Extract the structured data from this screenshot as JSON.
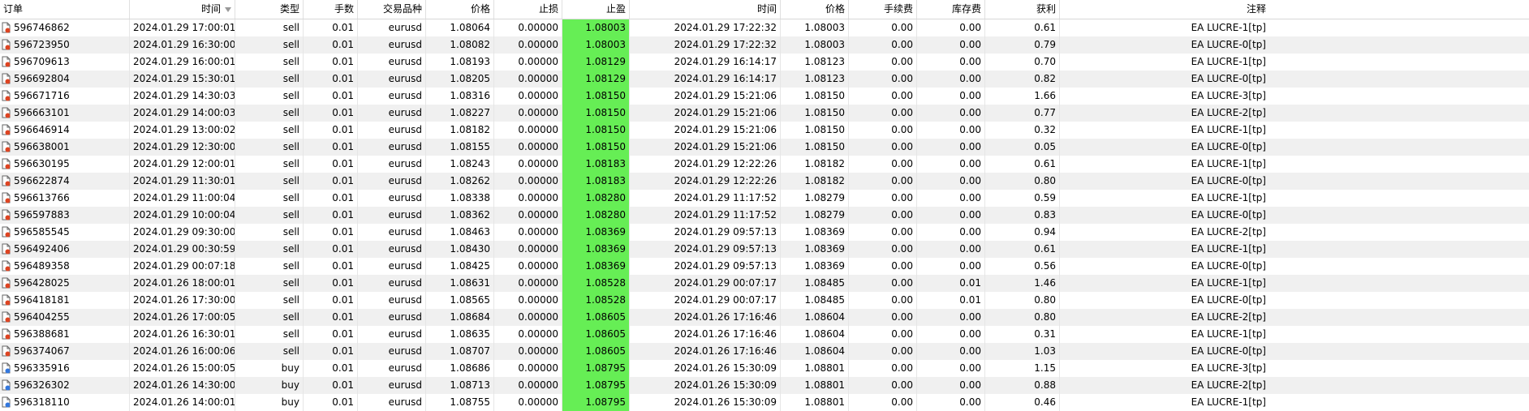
{
  "columns": {
    "order": "订单",
    "open_time": "时间",
    "type": "类型",
    "lots": "手数",
    "symbol": "交易品种",
    "open_price": "价格",
    "sl": "止损",
    "tp": "止盈",
    "close_time": "时间",
    "close_price": "价格",
    "commission": "手续费",
    "swap": "库存费",
    "profit": "获利",
    "comment": "注释"
  },
  "colors": {
    "tp_highlight": "#66ee55",
    "sell_icon": "#dd4422",
    "buy_icon": "#3377dd",
    "row_alt": "#f0f0f0"
  },
  "sort_icon": "sort-desc-icon",
  "rows": [
    {
      "order": "596746862",
      "open_time": "2024.01.29 17:00:01",
      "type": "sell",
      "lots": "0.01",
      "symbol": "eurusd",
      "open_price": "1.08064",
      "sl": "0.00000",
      "tp": "1.08003",
      "close_time": "2024.01.29 17:22:32",
      "close_price": "1.08003",
      "commission": "0.00",
      "swap": "0.00",
      "profit": "0.61",
      "comment": "EA LUCRE-1[tp]"
    },
    {
      "order": "596723950",
      "open_time": "2024.01.29 16:30:00",
      "type": "sell",
      "lots": "0.01",
      "symbol": "eurusd",
      "open_price": "1.08082",
      "sl": "0.00000",
      "tp": "1.08003",
      "close_time": "2024.01.29 17:22:32",
      "close_price": "1.08003",
      "commission": "0.00",
      "swap": "0.00",
      "profit": "0.79",
      "comment": "EA LUCRE-0[tp]"
    },
    {
      "order": "596709613",
      "open_time": "2024.01.29 16:00:01",
      "type": "sell",
      "lots": "0.01",
      "symbol": "eurusd",
      "open_price": "1.08193",
      "sl": "0.00000",
      "tp": "1.08129",
      "close_time": "2024.01.29 16:14:17",
      "close_price": "1.08123",
      "commission": "0.00",
      "swap": "0.00",
      "profit": "0.70",
      "comment": "EA LUCRE-1[tp]"
    },
    {
      "order": "596692804",
      "open_time": "2024.01.29 15:30:01",
      "type": "sell",
      "lots": "0.01",
      "symbol": "eurusd",
      "open_price": "1.08205",
      "sl": "0.00000",
      "tp": "1.08129",
      "close_time": "2024.01.29 16:14:17",
      "close_price": "1.08123",
      "commission": "0.00",
      "swap": "0.00",
      "profit": "0.82",
      "comment": "EA LUCRE-0[tp]"
    },
    {
      "order": "596671716",
      "open_time": "2024.01.29 14:30:03",
      "type": "sell",
      "lots": "0.01",
      "symbol": "eurusd",
      "open_price": "1.08316",
      "sl": "0.00000",
      "tp": "1.08150",
      "close_time": "2024.01.29 15:21:06",
      "close_price": "1.08150",
      "commission": "0.00",
      "swap": "0.00",
      "profit": "1.66",
      "comment": "EA LUCRE-3[tp]"
    },
    {
      "order": "596663101",
      "open_time": "2024.01.29 14:00:03",
      "type": "sell",
      "lots": "0.01",
      "symbol": "eurusd",
      "open_price": "1.08227",
      "sl": "0.00000",
      "tp": "1.08150",
      "close_time": "2024.01.29 15:21:06",
      "close_price": "1.08150",
      "commission": "0.00",
      "swap": "0.00",
      "profit": "0.77",
      "comment": "EA LUCRE-2[tp]"
    },
    {
      "order": "596646914",
      "open_time": "2024.01.29 13:00:02",
      "type": "sell",
      "lots": "0.01",
      "symbol": "eurusd",
      "open_price": "1.08182",
      "sl": "0.00000",
      "tp": "1.08150",
      "close_time": "2024.01.29 15:21:06",
      "close_price": "1.08150",
      "commission": "0.00",
      "swap": "0.00",
      "profit": "0.32",
      "comment": "EA LUCRE-1[tp]"
    },
    {
      "order": "596638001",
      "open_time": "2024.01.29 12:30:00",
      "type": "sell",
      "lots": "0.01",
      "symbol": "eurusd",
      "open_price": "1.08155",
      "sl": "0.00000",
      "tp": "1.08150",
      "close_time": "2024.01.29 15:21:06",
      "close_price": "1.08150",
      "commission": "0.00",
      "swap": "0.00",
      "profit": "0.05",
      "comment": "EA LUCRE-0[tp]"
    },
    {
      "order": "596630195",
      "open_time": "2024.01.29 12:00:01",
      "type": "sell",
      "lots": "0.01",
      "symbol": "eurusd",
      "open_price": "1.08243",
      "sl": "0.00000",
      "tp": "1.08183",
      "close_time": "2024.01.29 12:22:26",
      "close_price": "1.08182",
      "commission": "0.00",
      "swap": "0.00",
      "profit": "0.61",
      "comment": "EA LUCRE-1[tp]"
    },
    {
      "order": "596622874",
      "open_time": "2024.01.29 11:30:01",
      "type": "sell",
      "lots": "0.01",
      "symbol": "eurusd",
      "open_price": "1.08262",
      "sl": "0.00000",
      "tp": "1.08183",
      "close_time": "2024.01.29 12:22:26",
      "close_price": "1.08182",
      "commission": "0.00",
      "swap": "0.00",
      "profit": "0.80",
      "comment": "EA LUCRE-0[tp]"
    },
    {
      "order": "596613766",
      "open_time": "2024.01.29 11:00:04",
      "type": "sell",
      "lots": "0.01",
      "symbol": "eurusd",
      "open_price": "1.08338",
      "sl": "0.00000",
      "tp": "1.08280",
      "close_time": "2024.01.29 11:17:52",
      "close_price": "1.08279",
      "commission": "0.00",
      "swap": "0.00",
      "profit": "0.59",
      "comment": "EA LUCRE-1[tp]"
    },
    {
      "order": "596597883",
      "open_time": "2024.01.29 10:00:04",
      "type": "sell",
      "lots": "0.01",
      "symbol": "eurusd",
      "open_price": "1.08362",
      "sl": "0.00000",
      "tp": "1.08280",
      "close_time": "2024.01.29 11:17:52",
      "close_price": "1.08279",
      "commission": "0.00",
      "swap": "0.00",
      "profit": "0.83",
      "comment": "EA LUCRE-0[tp]"
    },
    {
      "order": "596585545",
      "open_time": "2024.01.29 09:30:00",
      "type": "sell",
      "lots": "0.01",
      "symbol": "eurusd",
      "open_price": "1.08463",
      "sl": "0.00000",
      "tp": "1.08369",
      "close_time": "2024.01.29 09:57:13",
      "close_price": "1.08369",
      "commission": "0.00",
      "swap": "0.00",
      "profit": "0.94",
      "comment": "EA LUCRE-2[tp]"
    },
    {
      "order": "596492406",
      "open_time": "2024.01.29 00:30:59",
      "type": "sell",
      "lots": "0.01",
      "symbol": "eurusd",
      "open_price": "1.08430",
      "sl": "0.00000",
      "tp": "1.08369",
      "close_time": "2024.01.29 09:57:13",
      "close_price": "1.08369",
      "commission": "0.00",
      "swap": "0.00",
      "profit": "0.61",
      "comment": "EA LUCRE-1[tp]"
    },
    {
      "order": "596489358",
      "open_time": "2024.01.29 00:07:18",
      "type": "sell",
      "lots": "0.01",
      "symbol": "eurusd",
      "open_price": "1.08425",
      "sl": "0.00000",
      "tp": "1.08369",
      "close_time": "2024.01.29 09:57:13",
      "close_price": "1.08369",
      "commission": "0.00",
      "swap": "0.00",
      "profit": "0.56",
      "comment": "EA LUCRE-0[tp]"
    },
    {
      "order": "596428025",
      "open_time": "2024.01.26 18:00:01",
      "type": "sell",
      "lots": "0.01",
      "symbol": "eurusd",
      "open_price": "1.08631",
      "sl": "0.00000",
      "tp": "1.08528",
      "close_time": "2024.01.29 00:07:17",
      "close_price": "1.08485",
      "commission": "0.00",
      "swap": "0.01",
      "profit": "1.46",
      "comment": "EA LUCRE-1[tp]"
    },
    {
      "order": "596418181",
      "open_time": "2024.01.26 17:30:00",
      "type": "sell",
      "lots": "0.01",
      "symbol": "eurusd",
      "open_price": "1.08565",
      "sl": "0.00000",
      "tp": "1.08528",
      "close_time": "2024.01.29 00:07:17",
      "close_price": "1.08485",
      "commission": "0.00",
      "swap": "0.01",
      "profit": "0.80",
      "comment": "EA LUCRE-0[tp]"
    },
    {
      "order": "596404255",
      "open_time": "2024.01.26 17:00:05",
      "type": "sell",
      "lots": "0.01",
      "symbol": "eurusd",
      "open_price": "1.08684",
      "sl": "0.00000",
      "tp": "1.08605",
      "close_time": "2024.01.26 17:16:46",
      "close_price": "1.08604",
      "commission": "0.00",
      "swap": "0.00",
      "profit": "0.80",
      "comment": "EA LUCRE-2[tp]"
    },
    {
      "order": "596388681",
      "open_time": "2024.01.26 16:30:01",
      "type": "sell",
      "lots": "0.01",
      "symbol": "eurusd",
      "open_price": "1.08635",
      "sl": "0.00000",
      "tp": "1.08605",
      "close_time": "2024.01.26 17:16:46",
      "close_price": "1.08604",
      "commission": "0.00",
      "swap": "0.00",
      "profit": "0.31",
      "comment": "EA LUCRE-1[tp]"
    },
    {
      "order": "596374067",
      "open_time": "2024.01.26 16:00:06",
      "type": "sell",
      "lots": "0.01",
      "symbol": "eurusd",
      "open_price": "1.08707",
      "sl": "0.00000",
      "tp": "1.08605",
      "close_time": "2024.01.26 17:16:46",
      "close_price": "1.08604",
      "commission": "0.00",
      "swap": "0.00",
      "profit": "1.03",
      "comment": "EA LUCRE-0[tp]"
    },
    {
      "order": "596335916",
      "open_time": "2024.01.26 15:00:05",
      "type": "buy",
      "lots": "0.01",
      "symbol": "eurusd",
      "open_price": "1.08686",
      "sl": "0.00000",
      "tp": "1.08795",
      "close_time": "2024.01.26 15:30:09",
      "close_price": "1.08801",
      "commission": "0.00",
      "swap": "0.00",
      "profit": "1.15",
      "comment": "EA LUCRE-3[tp]"
    },
    {
      "order": "596326302",
      "open_time": "2024.01.26 14:30:00",
      "type": "buy",
      "lots": "0.01",
      "symbol": "eurusd",
      "open_price": "1.08713",
      "sl": "0.00000",
      "tp": "1.08795",
      "close_time": "2024.01.26 15:30:09",
      "close_price": "1.08801",
      "commission": "0.00",
      "swap": "0.00",
      "profit": "0.88",
      "comment": "EA LUCRE-2[tp]"
    },
    {
      "order": "596318110",
      "open_time": "2024.01.26 14:00:01",
      "type": "buy",
      "lots": "0.01",
      "symbol": "eurusd",
      "open_price": "1.08755",
      "sl": "0.00000",
      "tp": "1.08795",
      "close_time": "2024.01.26 15:30:09",
      "close_price": "1.08801",
      "commission": "0.00",
      "swap": "0.00",
      "profit": "0.46",
      "comment": "EA LUCRE-1[tp]"
    }
  ]
}
